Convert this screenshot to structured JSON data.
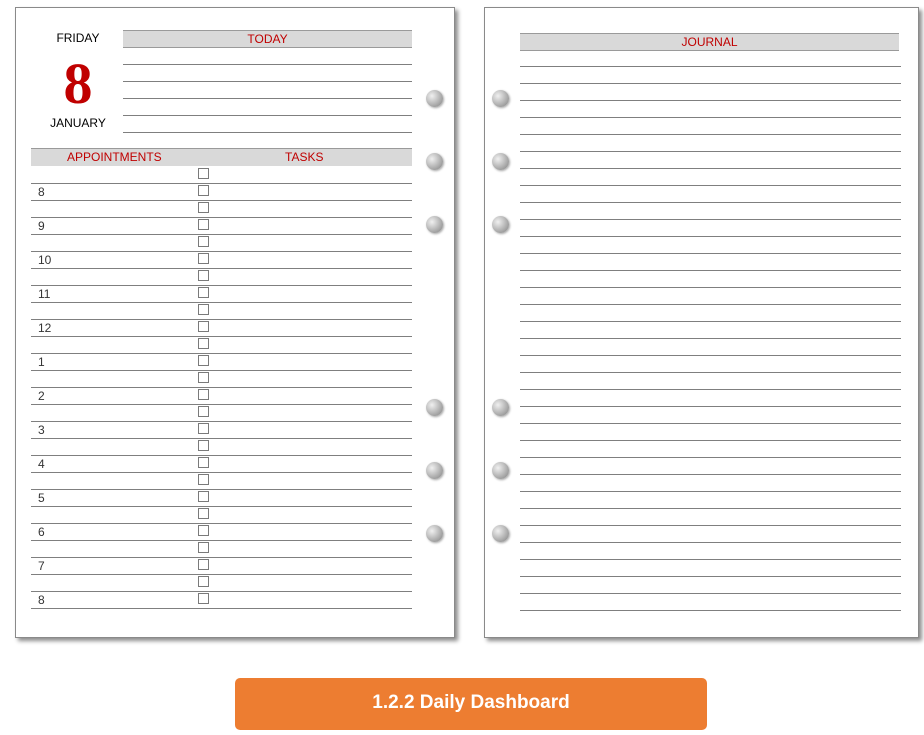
{
  "left_page": {
    "day_name": "FRIDAY",
    "day_number": "8",
    "month": "JANUARY",
    "today_label": "TODAY",
    "appointments_label": "APPOINTMENTS",
    "tasks_label": "TASKS",
    "hours": [
      "",
      "8",
      "",
      "9",
      "",
      "10",
      "",
      "11",
      "",
      "12",
      "",
      "1",
      "",
      "2",
      "",
      "3",
      "",
      "4",
      "",
      "5",
      "",
      "6",
      "",
      "7",
      "",
      "8"
    ]
  },
  "right_page": {
    "journal_label": "JOURNAL"
  },
  "footer": {
    "title": "1.2.2 Daily Dashboard"
  },
  "colors": {
    "accent_red": "#c00000",
    "banner_orange": "#ed7d31",
    "header_gray": "#d9d9d9"
  }
}
